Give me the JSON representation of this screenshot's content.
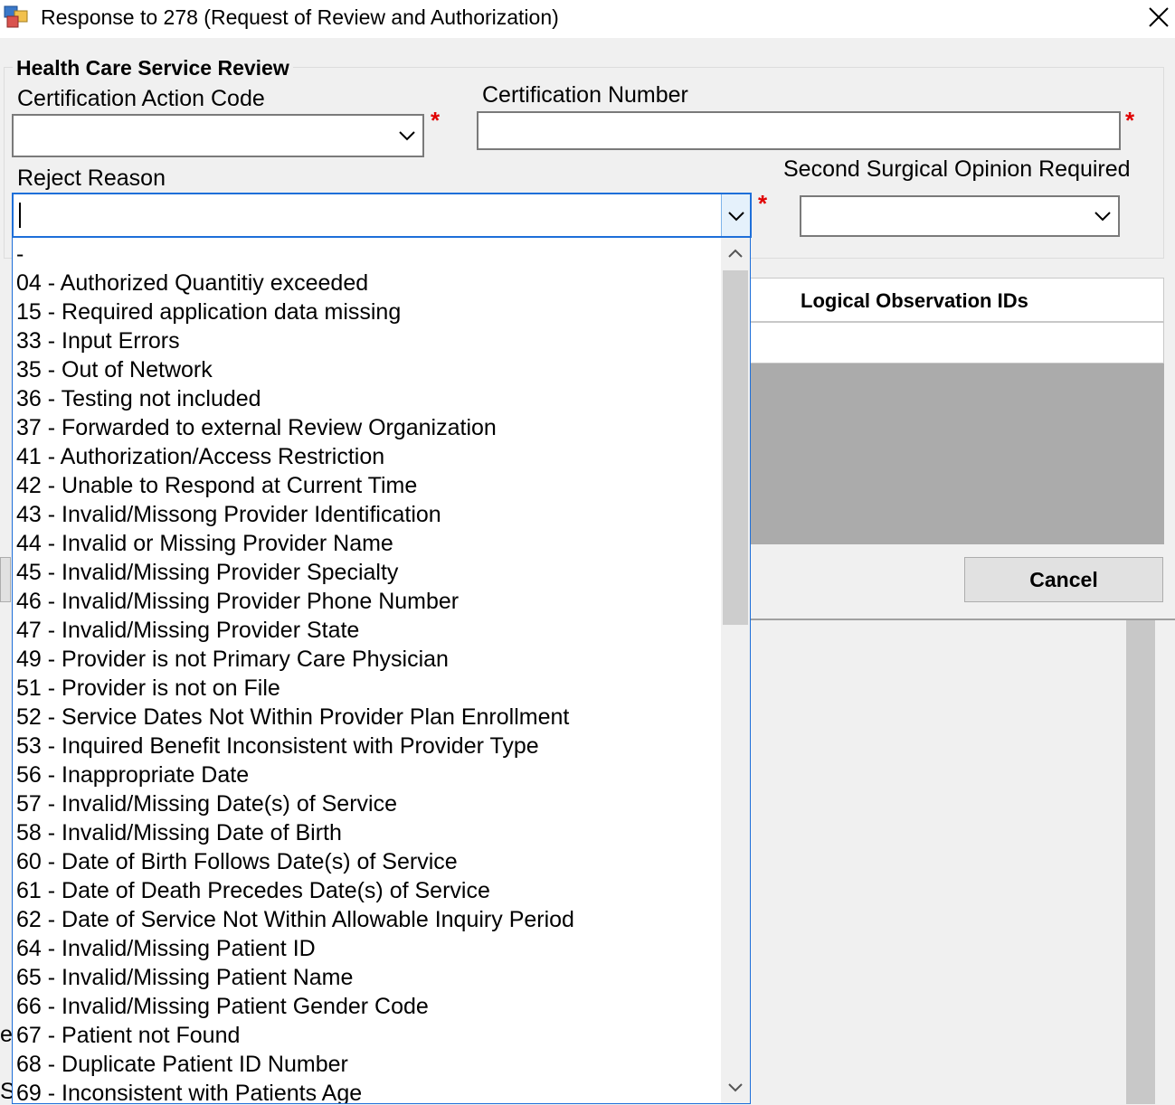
{
  "window": {
    "title": "Response to 278 (Request of Review and Authorization)",
    "icon": "app-window-icon",
    "close_icon": "close-icon"
  },
  "group": {
    "title": "Health Care Service Review",
    "certification_action_code": {
      "label": "Certification Action Code",
      "value": "",
      "required": "*"
    },
    "certification_number": {
      "label": "Certification Number",
      "value": "",
      "required": "*"
    },
    "reject_reason": {
      "label": "Reject Reason",
      "value": "",
      "required": "*"
    },
    "second_surgical_opinion": {
      "label": "Second Surgical Opinion Required",
      "value": ""
    }
  },
  "grid": {
    "column_header": "Logical Observation IDs"
  },
  "buttons": {
    "cancel": "Cancel"
  },
  "background_fragments": {
    "frag1": "e",
    "frag2": "S"
  },
  "reject_reason_options": [
    "-",
    "04 - Authorized Quantitiy exceeded",
    "15 - Required application data missing",
    "33 - Input Errors",
    "35 - Out of Network",
    "36 - Testing not included",
    "37 - Forwarded to external Review Organization",
    "41 - Authorization/Access Restriction",
    "42 - Unable to Respond at Current Time",
    "43 - Invalid/Missong Provider Identification",
    "44 - Invalid or Missing Provider Name",
    "45 - Invalid/Missing Provider Specialty",
    "46 - Invalid/Missing Provider Phone Number",
    "47 - Invalid/Missing Provider State",
    "49 - Provider is not Primary Care Physician",
    "51 - Provider is not on File",
    "52 - Service Dates Not Within Provider Plan Enrollment",
    "53 - Inquired Benefit Inconsistent with Provider Type",
    "56 - Inappropriate Date",
    "57 - Invalid/Missing Date(s) of Service",
    "58 - Invalid/Missing Date of Birth",
    "60 - Date of Birth Follows Date(s) of Service",
    "61 - Date of Death Precedes Date(s) of Service",
    "62 - Date of Service Not Within Allowable Inquiry Period",
    "64 - Invalid/Missing Patient ID",
    "65 - Invalid/Missing Patient Name",
    "66 - Invalid/Missing Patient Gender Code",
    "67 - Patient not Found",
    "68 - Duplicate Patient ID Number",
    "69 - Inconsistent with Patients Age"
  ],
  "colors": {
    "required": "#e00000",
    "focus_border": "#1e6fd9",
    "window_bg": "#f0f0f0",
    "grid_empty": "#ababab"
  }
}
